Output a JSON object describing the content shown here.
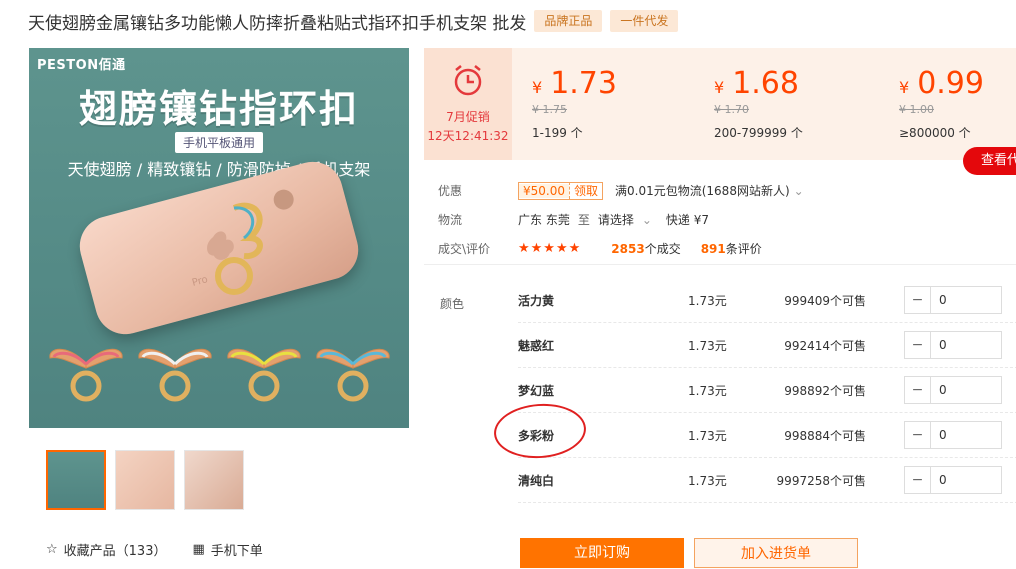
{
  "title": "天使翅膀金属镶钻多功能懒人防摔折叠粘贴式指环扣手机支架 批发",
  "tags": [
    "品牌正品",
    "一件代发"
  ],
  "image": {
    "brand": "PESTON佰通",
    "headline": "翅膀镶钻指环扣",
    "badge": "手机平板通用",
    "subline": "天使翅膀 / 精致镶钻 / 防滑防掉 / 手机支架",
    "phone_mark": "Pro"
  },
  "promo": {
    "label": "7月促销",
    "timer": "12天12:41:32"
  },
  "prices": [
    {
      "currency": "¥",
      "price": "1.73",
      "old": "¥ 1.75",
      "range": "1-199 个"
    },
    {
      "currency": "¥",
      "price": "1.68",
      "old": "¥ 1.70",
      "range": "200-799999 个"
    },
    {
      "currency": "¥",
      "price": "0.99",
      "old": "¥ 1.00",
      "range": "≥800000 个"
    }
  ],
  "view_button": "查看代",
  "info": {
    "discount_label": "优惠",
    "coupon_amount": "¥50.00",
    "coupon_get": "领取",
    "discount_text": "满0.01元包物流(1688网站新人)",
    "logistics_label": "物流",
    "origin": "广东 东莞",
    "to": "至",
    "dest": "请选择",
    "express": "快递 ¥7",
    "deals_label": "成交\\评价",
    "stars": "★★★★★",
    "deals_count": "2853",
    "deals_suffix": "个成交",
    "review_count": "891",
    "review_suffix": "条评价"
  },
  "sku_label": "颜色",
  "skus": [
    {
      "name": "活力黄",
      "price": "1.73元",
      "stock": "999409个可售",
      "qty": "0"
    },
    {
      "name": "魅惑红",
      "price": "1.73元",
      "stock": "992414个可售",
      "qty": "0"
    },
    {
      "name": "梦幻蓝",
      "price": "1.73元",
      "stock": "998892个可售",
      "qty": "0"
    },
    {
      "name": "多彩粉",
      "price": "1.73元",
      "stock": "998884个可售",
      "qty": "0"
    },
    {
      "name": "清纯白",
      "price": "1.73元",
      "stock": "9997258个可售",
      "qty": "0"
    }
  ],
  "bottom": {
    "fav": "收藏产品（133）",
    "mobile": "手机下单"
  },
  "buttons": {
    "buy": "立即订购",
    "cart": "加入进货单"
  },
  "colors": {
    "accent": "#ff6600",
    "price": "#ff4400",
    "red": "#e4080c"
  }
}
